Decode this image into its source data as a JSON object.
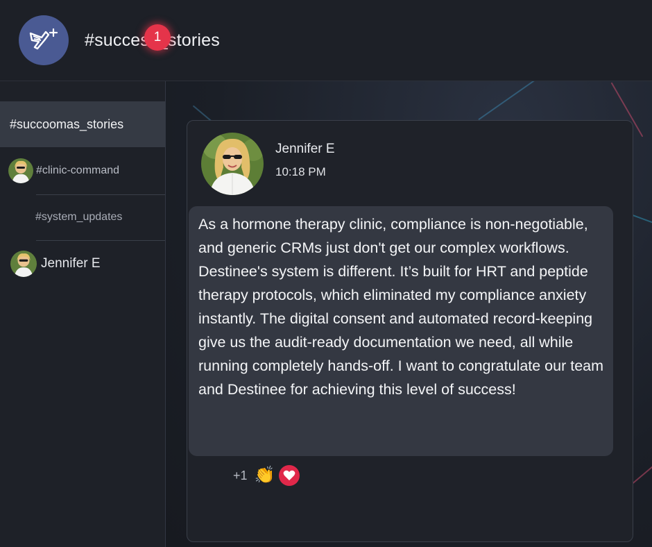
{
  "header": {
    "logo_icon": "dove-plus-icon",
    "channel_title": "#success_stories"
  },
  "sidebar": {
    "active_channel": "#succoomas_stories",
    "badge_count": "1",
    "items": [
      {
        "label": "#clinic-command",
        "icon": "user-avatar"
      },
      {
        "label": "#system_updates"
      },
      {
        "label": "Jennifer E",
        "icon": "user-avatar"
      }
    ]
  },
  "message": {
    "author": "Jennifer E",
    "time": "10:18 PM",
    "text": "As a hormone therapy clinic, compliance is non-negotiable, and generic CRMs just don't get our complex workflows. Destinee's system is different. It’s built for HRT and peptide therapy protocols, which eliminated my compliance anxiety instantly. The digital consent and automated record-keeping give us the audit-ready documentation we need, all while running completely hands-off. I want to congratulate our team and Destinee for achieving this level of success!",
    "reactions": {
      "count_label": "+1",
      "clap_emoji": "👏",
      "heart_icon": "heart-icon"
    }
  },
  "colors": {
    "accent_logo": "#4a5a93",
    "badge": "#e5344a",
    "heart": "#e0284a",
    "bubble": "#343842"
  }
}
